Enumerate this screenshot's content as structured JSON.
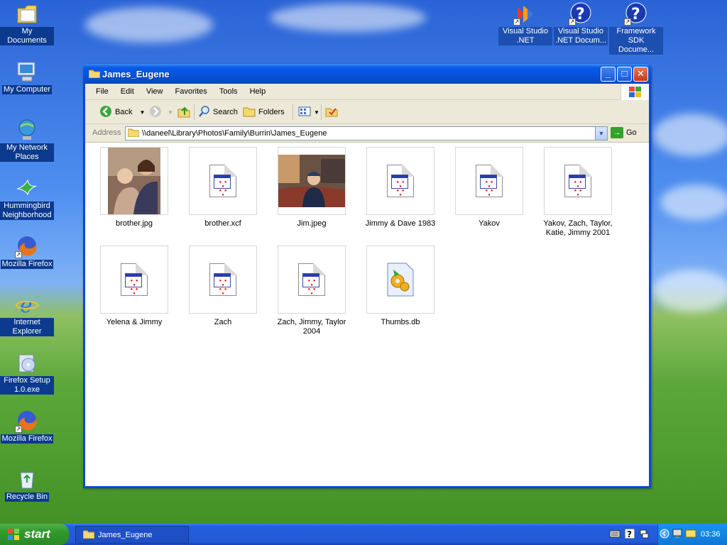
{
  "desktop": {
    "icons_left": [
      {
        "label": "My Documents",
        "icon": "my-documents-icon"
      },
      {
        "label": "My Computer",
        "icon": "my-computer-icon"
      },
      {
        "label": "My Network Places",
        "icon": "network-places-icon"
      },
      {
        "label": "Hummingbird Neighborhood",
        "icon": "hummingbird-icon"
      },
      {
        "label": "Mozilla Firefox",
        "icon": "firefox-icon"
      },
      {
        "label": "Internet Explorer",
        "icon": "internet-explorer-icon"
      },
      {
        "label": "Firefox Setup 1.0.exe",
        "icon": "setup-installer-icon"
      },
      {
        "label": "Mozilla Firefox",
        "icon": "firefox-icon"
      },
      {
        "label": "Recycle Bin",
        "icon": "recycle-bin-icon"
      }
    ],
    "icons_top": [
      {
        "label": "Visual Studio .NET",
        "icon": "visual-studio-icon"
      },
      {
        "label": "Visual Studio .NET Docum...",
        "icon": "help-icon"
      },
      {
        "label": "Framework SDK Docume...",
        "icon": "help-icon"
      }
    ]
  },
  "window": {
    "title": "James_Eugene",
    "menu": [
      "File",
      "Edit",
      "View",
      "Favorites",
      "Tools",
      "Help"
    ],
    "toolbar": {
      "back": "Back",
      "search": "Search",
      "folders": "Folders"
    },
    "address": {
      "label": "Address",
      "value": "\\\\daneel\\Library\\Photos\\Family\\Burrin\\James_Eugene",
      "go": "Go"
    },
    "files": [
      {
        "name": "brother.jpg",
        "type": "photo"
      },
      {
        "name": "brother.xcf",
        "type": "generic"
      },
      {
        "name": "Jim.jpeg",
        "type": "photo"
      },
      {
        "name": "Jimmy & Dave 1983",
        "type": "generic"
      },
      {
        "name": "Yakov",
        "type": "generic"
      },
      {
        "name": "Yakov, Zach, Taylor, Katie, Jimmy 2001",
        "type": "generic"
      },
      {
        "name": "Yelena & Jimmy",
        "type": "generic"
      },
      {
        "name": "Zach",
        "type": "generic"
      },
      {
        "name": "Zach, Jimmy, Taylor 2004",
        "type": "generic"
      },
      {
        "name": "Thumbs.db",
        "type": "system"
      }
    ]
  },
  "taskbar": {
    "start": "start",
    "task": "James_Eugene",
    "clock": "03:36"
  },
  "colors": {
    "titlebar": "#0a5ae8",
    "taskbar": "#245edc",
    "start": "#2f9a2a",
    "menubar": "#ece9d8"
  }
}
